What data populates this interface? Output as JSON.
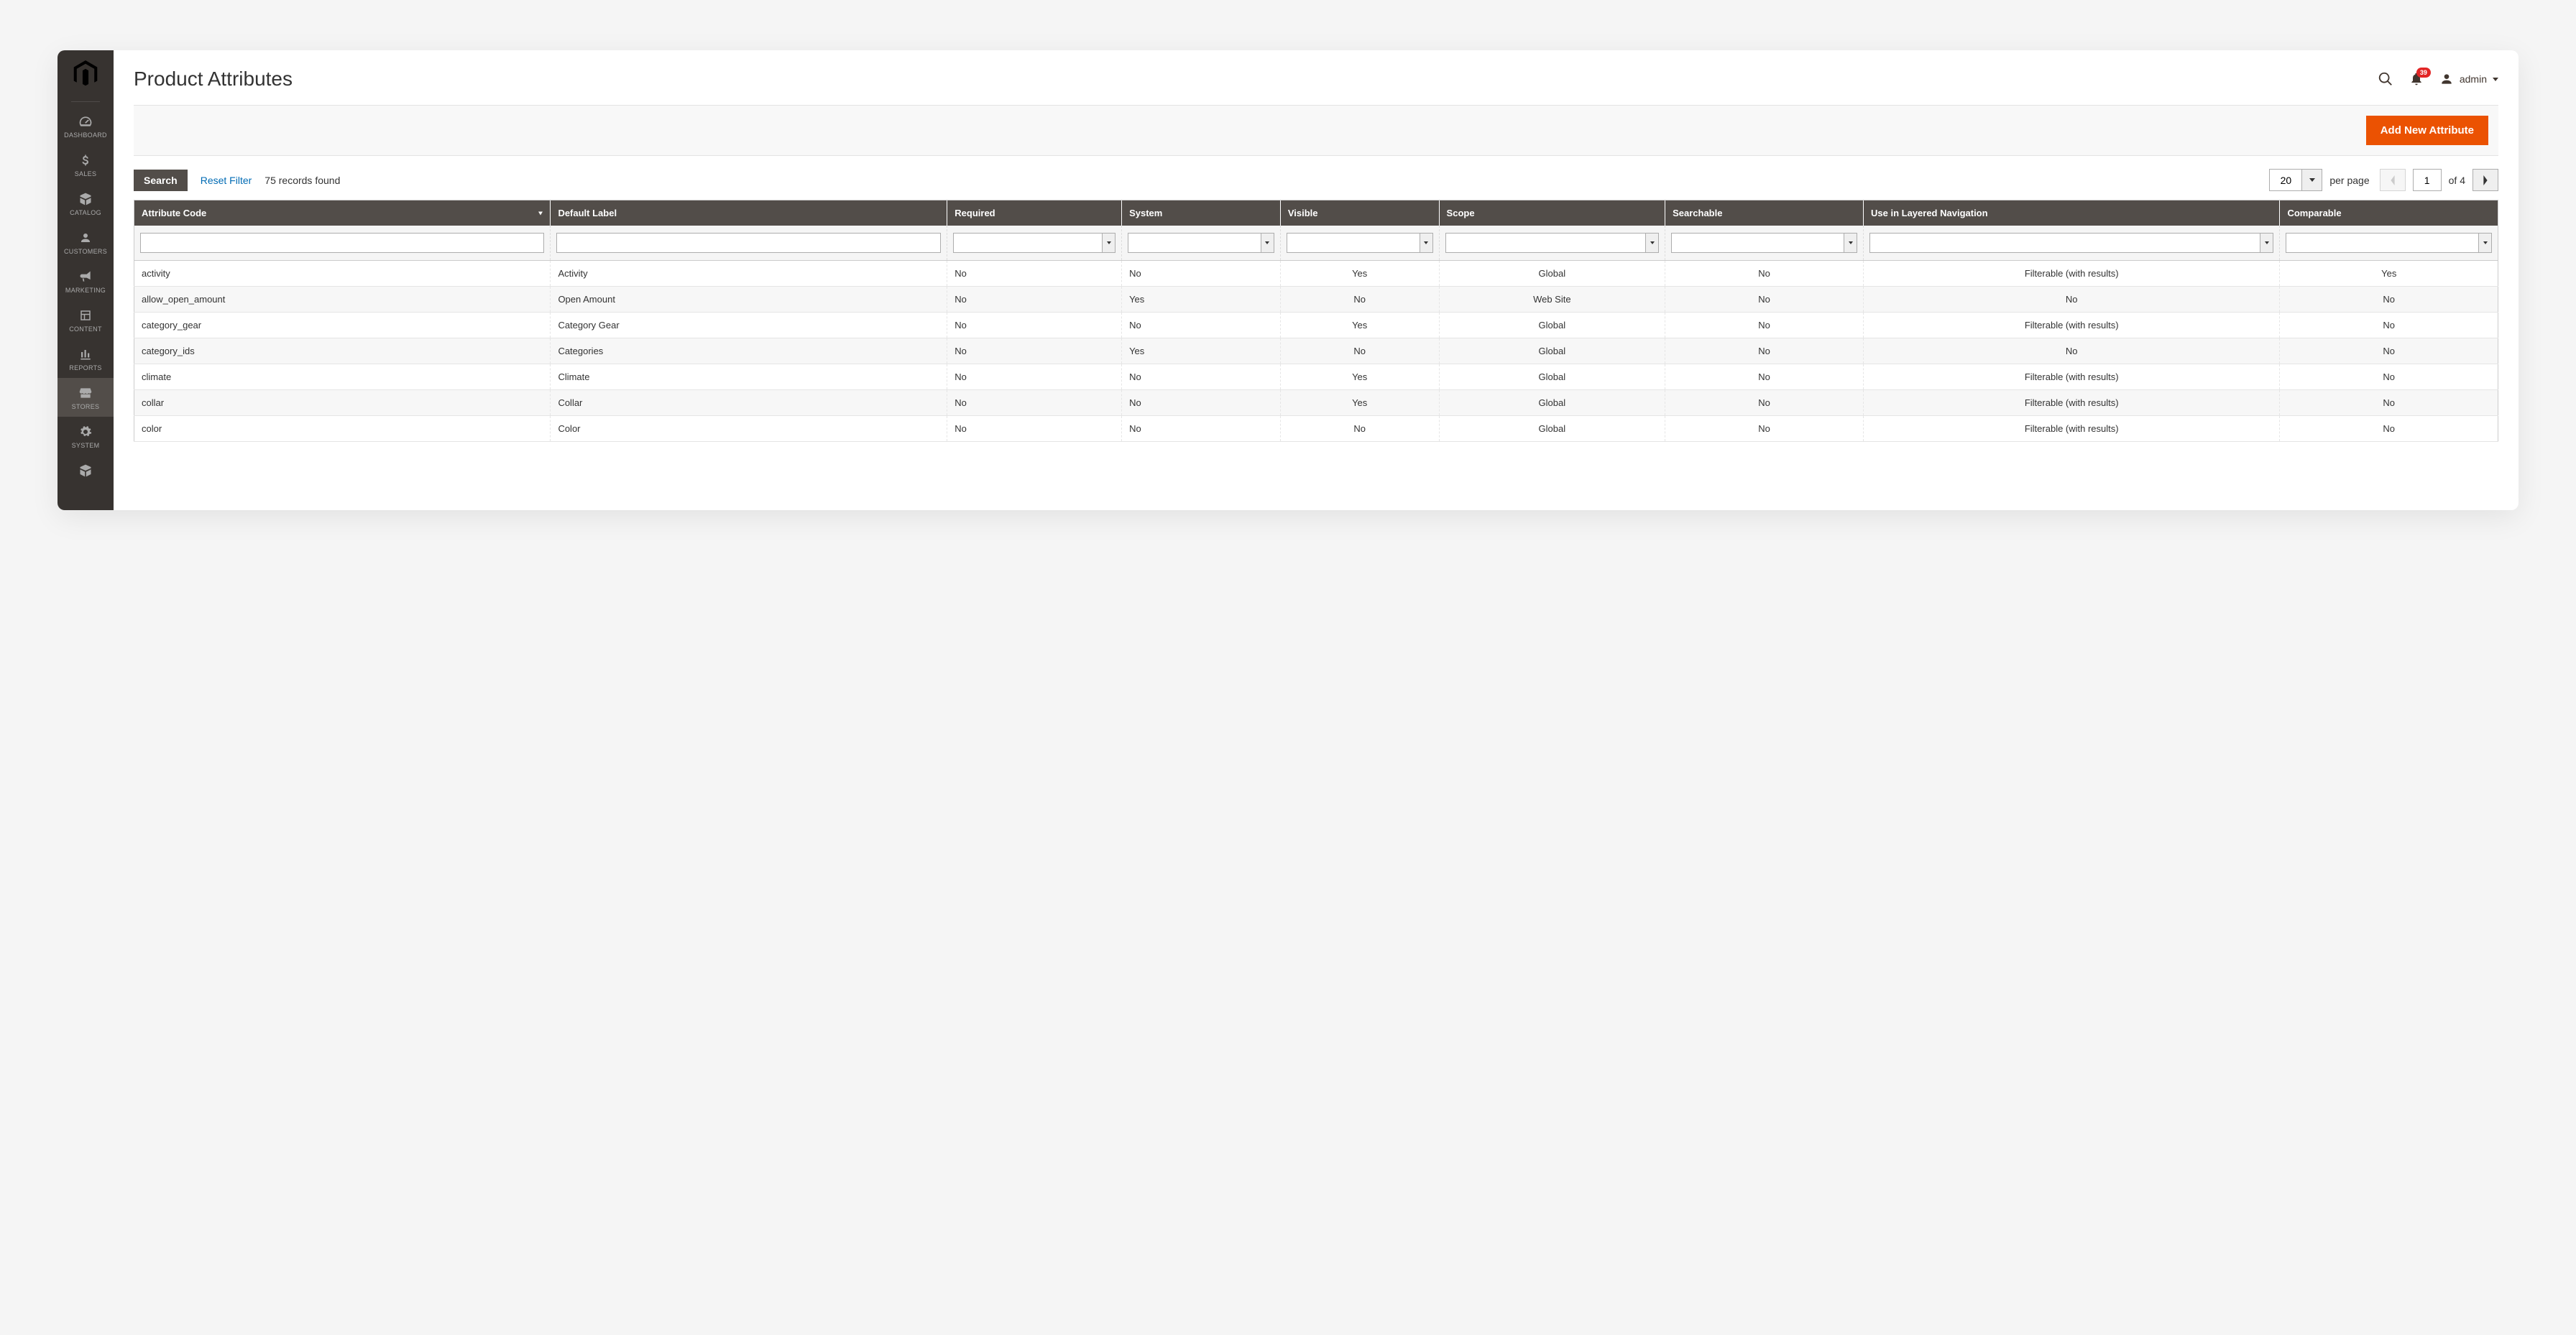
{
  "sidebar": {
    "items": [
      {
        "label": "DASHBOARD"
      },
      {
        "label": "SALES"
      },
      {
        "label": "CATALOG"
      },
      {
        "label": "CUSTOMERS"
      },
      {
        "label": "MARKETING"
      },
      {
        "label": "CONTENT"
      },
      {
        "label": "REPORTS"
      },
      {
        "label": "STORES"
      },
      {
        "label": "SYSTEM"
      }
    ]
  },
  "header": {
    "title": "Product Attributes",
    "notification_count": "39",
    "username": "admin"
  },
  "actions": {
    "add_new": "Add New Attribute"
  },
  "controls": {
    "search_label": "Search",
    "reset_label": "Reset Filter",
    "records_found": "75 records found",
    "page_size": "20",
    "per_page_label": "per page",
    "current_page": "1",
    "total_pages_label": "of 4"
  },
  "table": {
    "columns": [
      "Attribute Code",
      "Default Label",
      "Required",
      "System",
      "Visible",
      "Scope",
      "Searchable",
      "Use in Layered Navigation",
      "Comparable"
    ],
    "rows": [
      {
        "code": "activity",
        "label": "Activity",
        "required": "No",
        "system": "No",
        "visible": "Yes",
        "scope": "Global",
        "searchable": "No",
        "layered": "Filterable (with results)",
        "comparable": "Yes"
      },
      {
        "code": "allow_open_amount",
        "label": "Open Amount",
        "required": "No",
        "system": "Yes",
        "visible": "No",
        "scope": "Web Site",
        "searchable": "No",
        "layered": "No",
        "comparable": "No"
      },
      {
        "code": "category_gear",
        "label": "Category Gear",
        "required": "No",
        "system": "No",
        "visible": "Yes",
        "scope": "Global",
        "searchable": "No",
        "layered": "Filterable (with results)",
        "comparable": "No"
      },
      {
        "code": "category_ids",
        "label": "Categories",
        "required": "No",
        "system": "Yes",
        "visible": "No",
        "scope": "Global",
        "searchable": "No",
        "layered": "No",
        "comparable": "No"
      },
      {
        "code": "climate",
        "label": "Climate",
        "required": "No",
        "system": "No",
        "visible": "Yes",
        "scope": "Global",
        "searchable": "No",
        "layered": "Filterable (with results)",
        "comparable": "No"
      },
      {
        "code": "collar",
        "label": "Collar",
        "required": "No",
        "system": "No",
        "visible": "Yes",
        "scope": "Global",
        "searchable": "No",
        "layered": "Filterable (with results)",
        "comparable": "No"
      },
      {
        "code": "color",
        "label": "Color",
        "required": "No",
        "system": "No",
        "visible": "No",
        "scope": "Global",
        "searchable": "No",
        "layered": "Filterable (with results)",
        "comparable": "No"
      }
    ]
  }
}
